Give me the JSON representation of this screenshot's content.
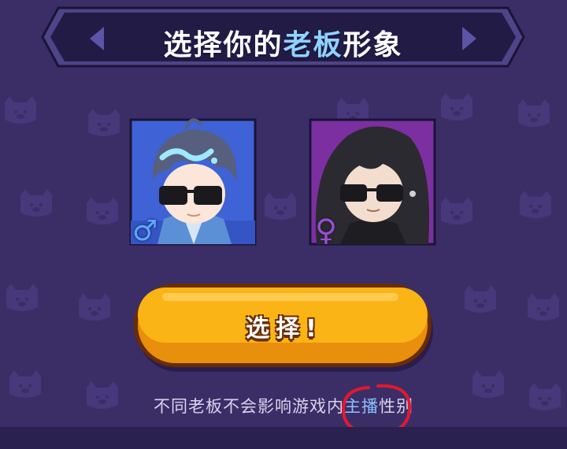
{
  "title": {
    "part1": "选择你的",
    "highlight": "老板",
    "part2": "形象"
  },
  "avatars": [
    {
      "gender_symbol": "♂",
      "color": "#3f62d6",
      "selected": true
    },
    {
      "gender_symbol": "♀",
      "color": "#7c2fa0",
      "selected": false
    }
  ],
  "select_button": {
    "label": "选择!"
  },
  "hint": {
    "part1": "不同老板不会影响游戏内",
    "highlight": "主播",
    "part2": "性别"
  },
  "colors": {
    "background": "#3b2e66",
    "banner": "#221b45",
    "button": "#fbb416",
    "highlight": "#8fd3ff",
    "annotation": "#e0192e"
  }
}
